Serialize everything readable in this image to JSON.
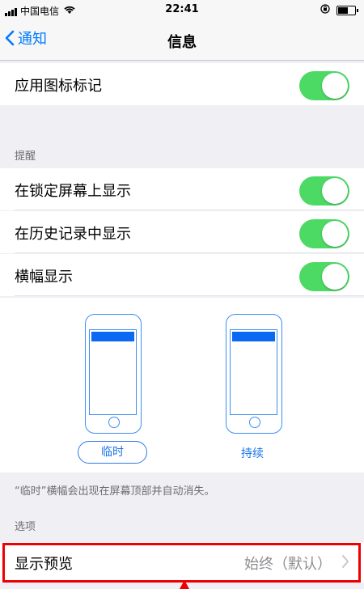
{
  "status": {
    "carrier": "中国电信",
    "time": "22:41"
  },
  "nav": {
    "back_label": "通知",
    "title": "信息"
  },
  "rows": {
    "app_badge": {
      "label": "应用图标标记"
    },
    "lock_screen": {
      "label": "在锁定屏幕上显示"
    },
    "history": {
      "label": "在历史记录中显示"
    },
    "banners": {
      "label": "横幅显示"
    }
  },
  "sections": {
    "alerts": "提醒",
    "options": "选项"
  },
  "banner_styles": {
    "temporary": "临时",
    "persistent": "持续"
  },
  "footnote": "“临时”横幅会出现在屏幕顶部并自动消失。",
  "preview": {
    "label": "显示预览",
    "value": "始终（默认）"
  },
  "colors": {
    "toggle_on": "#4cd964",
    "link": "#007aff",
    "highlight": "#ee0000"
  }
}
